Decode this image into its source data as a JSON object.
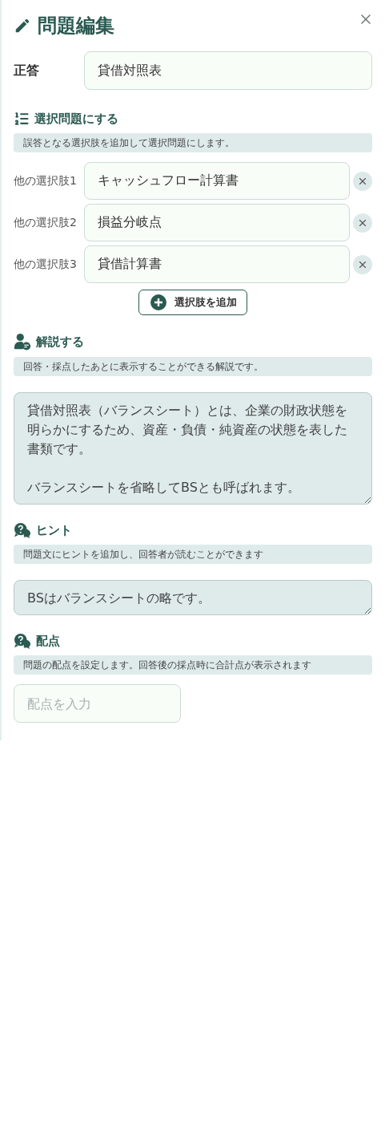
{
  "title": "問題編集",
  "answer": {
    "label": "正答",
    "value": "貸借対照表"
  },
  "sections": [
    {
      "kind": "choices",
      "heading": "選択問題にする",
      "description": "誤答となる選択肢を追加して選択問題にします。",
      "choices": [
        {
          "label": "他の選択肢1",
          "value": "キャッシュフロー計算書"
        },
        {
          "label": "他の選択肢2",
          "value": "損益分岐点"
        },
        {
          "label": "他の選択肢3",
          "value": "貸借計算書"
        }
      ],
      "add_button": "選択肢を追加"
    },
    {
      "kind": "textarea",
      "heading": "解説する",
      "description": "回答・採点したあとに表示することができる解説です。",
      "paragraphs": [
        "貸借対照表（バランスシート）とは、企業の財政状態を明らかにするため、資産・負債・純資産の状態を表した書類です。",
        "バランスシートを省略してBSとも呼ばれます。"
      ]
    },
    {
      "kind": "textarea",
      "heading": "ヒント",
      "description": "問題文にヒントを追加し、回答者が読むことができます",
      "paragraphs": [
        "BSはバランスシートの略です。"
      ]
    },
    {
      "kind": "input",
      "heading": "配点",
      "description": "問題の配点を設定します。回答後の採点時に合計点が表示されます",
      "placeholder": "配点を入力"
    }
  ]
}
